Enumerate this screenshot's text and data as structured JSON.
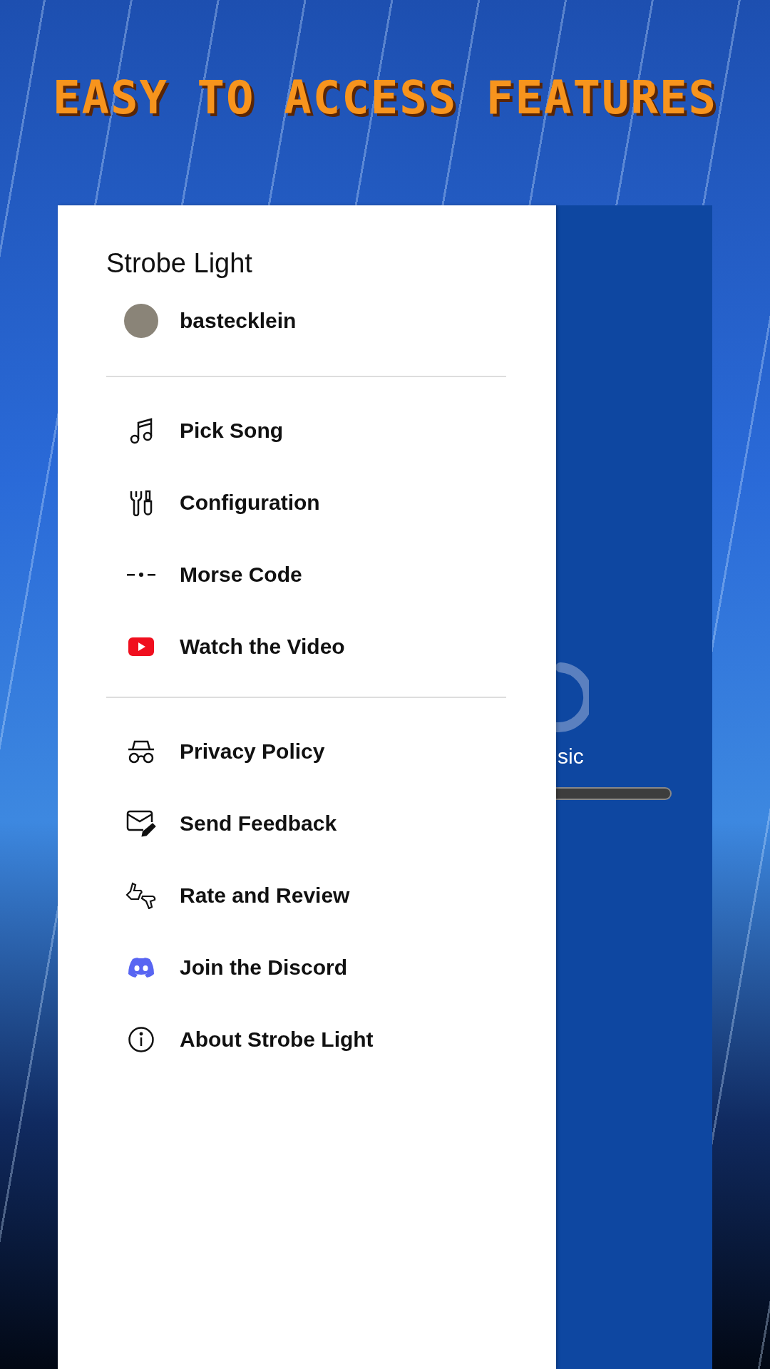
{
  "headline": "EASY TO ACCESS FEATURES",
  "drawer": {
    "title": "Strobe Light",
    "user": {
      "name": "bastecklein"
    },
    "sections": [
      [
        {
          "kind": "song",
          "label": "Pick Song"
        },
        {
          "kind": "config",
          "label": "Configuration"
        },
        {
          "kind": "morse",
          "label": "Morse Code"
        },
        {
          "kind": "video",
          "label": "Watch the Video"
        }
      ],
      [
        {
          "kind": "privacy",
          "label": "Privacy Policy"
        },
        {
          "kind": "feedback",
          "label": "Send Feedback"
        },
        {
          "kind": "rate",
          "label": "Rate and Review"
        },
        {
          "kind": "discord",
          "label": "Join the Discord"
        },
        {
          "kind": "about",
          "label": "About Strobe Light"
        }
      ]
    ]
  },
  "behind": {
    "status_text": "sic"
  }
}
